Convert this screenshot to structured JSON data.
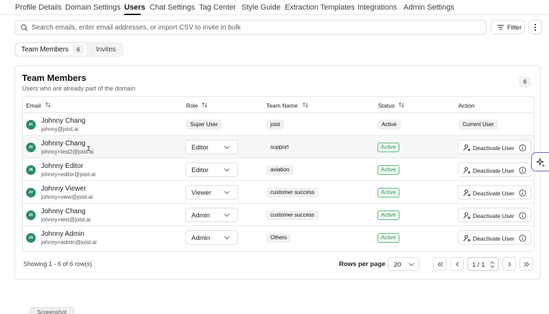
{
  "nav": {
    "tabs": [
      "Profile Details",
      "Domain Settings",
      "Users",
      "Chat Settings",
      "Tag Center",
      "Style Guide",
      "Extraction Templates",
      "Integrations",
      "Admin Settings"
    ],
    "active": "Users"
  },
  "search": {
    "placeholder": "Search emails, enter email addresses, or import CSV to invite in bulk",
    "value": ""
  },
  "toolbar": {
    "filter_label": "Filter"
  },
  "segment": {
    "members_label": "Team Members",
    "members_count": "6",
    "invites_label": "Invites"
  },
  "card": {
    "title": "Team Members",
    "subtitle": "Users who are already part of the domain",
    "count": "6"
  },
  "table": {
    "headers": {
      "email": "Email",
      "role": "Role",
      "team": "Team Name",
      "status": "Status",
      "action": "Action"
    },
    "rows": [
      {
        "initials": "JC",
        "name": "Johnny Chang",
        "email": "johnny@joist.ai",
        "role": "Super User",
        "team": "joist",
        "status": "Active",
        "action": "Current User"
      },
      {
        "initials": "JC",
        "name": "Johnny Chang",
        "email": "johnny+test2@joist.ai",
        "role": "Editor",
        "team": "support",
        "status": "Active",
        "action": "Deactivate User"
      },
      {
        "initials": "JE",
        "name": "Johnny Editor",
        "email": "johnny+editor@joist.ai",
        "role": "Editor",
        "team": "aviation",
        "status": "Active",
        "action": "Deactivate User"
      },
      {
        "initials": "JV",
        "name": "Johnny Viewer",
        "email": "johnny+view@joist.ai",
        "role": "Viewer",
        "team": "customer success",
        "status": "Active",
        "action": "Deactivate User"
      },
      {
        "initials": "JC",
        "name": "Johnny Chang",
        "email": "johnny+test@joist.ai",
        "role": "Admin",
        "team": "customer success",
        "status": "Active",
        "action": "Deactivate User"
      },
      {
        "initials": "JA",
        "name": "Johnny Admin",
        "email": "johnny+admin@joist.ai",
        "role": "Admin",
        "team": "Others",
        "status": "Active",
        "action": "Deactivate User"
      }
    ]
  },
  "footer": {
    "showing": "Showing 1 - 6 of 6 row(s)",
    "rows_per_page_label": "Rows per page",
    "rows_per_page": "20",
    "page": "1 / 1"
  },
  "floating": {
    "screenshot_label": "Screenshot"
  },
  "colors": {
    "avatar": "#2e8b65",
    "active_border": "#58b97d",
    "active_text": "#2e9a5a",
    "assistant_border": "#7c5cc4"
  },
  "icons": {
    "search": "search-icon",
    "filter": "filter-icon",
    "more": "more-vertical-icon",
    "sort": "sort-icon",
    "chevron": "chevron-down-icon",
    "user_remove": "user-remove-icon",
    "info": "info-icon",
    "sparkle": "sparkle-icon"
  }
}
